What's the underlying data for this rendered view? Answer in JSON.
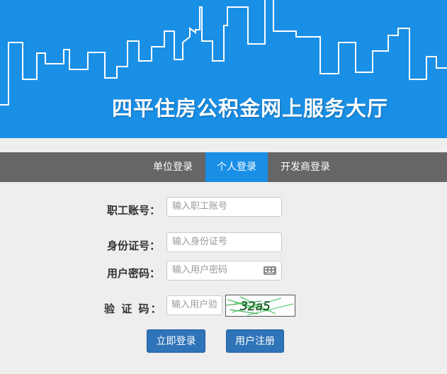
{
  "banner": {
    "title": "四平住房公积金网上服务大厅",
    "bg_color": "#1a8fe6"
  },
  "tabs": [
    {
      "label": "单位登录",
      "active": false
    },
    {
      "label": "个人登录",
      "active": true
    },
    {
      "label": "开发商登录",
      "active": false
    }
  ],
  "form": {
    "account": {
      "label": "职工账号：",
      "placeholder": "输入职工账号"
    },
    "idcard": {
      "label": "身份证号：",
      "placeholder": "输入身份证号"
    },
    "password": {
      "label": "用户密码：",
      "placeholder": "输入用户密码",
      "icon": "keyboard-icon"
    },
    "captcha": {
      "label": "验 证 码：",
      "placeholder": "输入用户验",
      "image_text": "32a5"
    }
  },
  "buttons": {
    "login": "立即登录",
    "register": "用户注册"
  },
  "colors": {
    "accent": "#1a8fe6",
    "tab_bar": "#666666",
    "button": "#2f73b8"
  }
}
